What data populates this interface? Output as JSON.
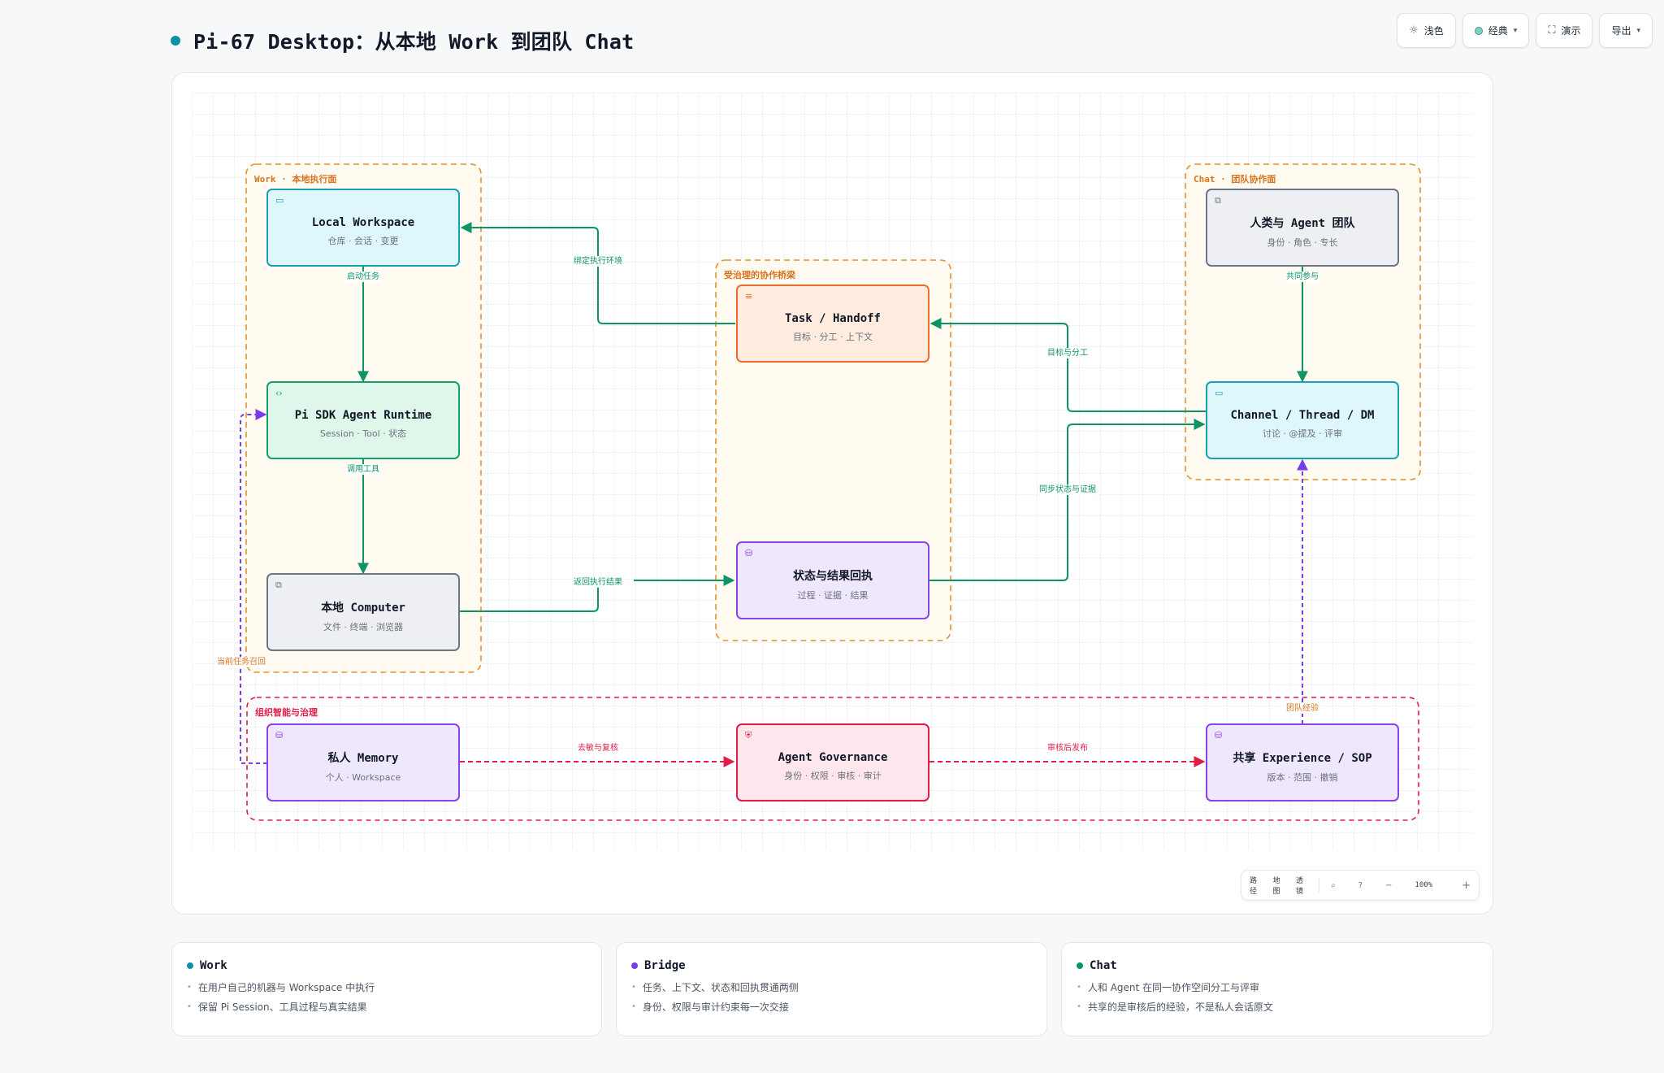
{
  "page": {
    "title": "Pi-67 Desktop：从本地 Work 到团队 Chat"
  },
  "toolbar": {
    "theme_label": "浅色",
    "style_label": "经典",
    "present_label": "演示",
    "export_label": "导出"
  },
  "groups": {
    "work": {
      "label": "Work · 本地执行面"
    },
    "bridge": {
      "label": "受治理的协作桥梁"
    },
    "chat": {
      "label": "Chat · 团队协作面"
    },
    "org": {
      "label": "组织智能与治理"
    }
  },
  "nodes": {
    "local_workspace": {
      "title": "Local Workspace",
      "sub": "仓库 · 会话 · 变更",
      "icon": "window-icon"
    },
    "agent_runtime": {
      "title": "Pi SDK Agent Runtime",
      "sub": "Session · Tool · 状态",
      "icon": "code-icon"
    },
    "local_computer": {
      "title": "本地 Computer",
      "sub": "文件 · 终端 · 浏览器",
      "icon": "external-link-icon"
    },
    "task_handoff": {
      "title": "Task / Handoff",
      "sub": "目标 · 分工 · 上下文",
      "icon": "list-icon"
    },
    "status_receipt": {
      "title": "状态与结果回执",
      "sub": "过程 · 证据 · 结果",
      "icon": "database-icon"
    },
    "team": {
      "title": "人类与 Agent 团队",
      "sub": "身份 · 角色 · 专长",
      "icon": "external-link-icon"
    },
    "channel": {
      "title": "Channel / Thread / DM",
      "sub": "讨论 · @提及 · 评审",
      "icon": "window-icon"
    },
    "memory": {
      "title": "私人 Memory",
      "sub": "个人 · Workspace",
      "icon": "database-icon"
    },
    "governance": {
      "title": "Agent Governance",
      "sub": "身份 · 权限 · 审核 · 审计",
      "icon": "shield-icon"
    },
    "experience": {
      "title": "共享 Experience / SOP",
      "sub": "版本 · 范围 · 撤销",
      "icon": "database-icon"
    }
  },
  "edges": {
    "start_task": "启动任务",
    "call_tool": "调用工具",
    "bind_env": "绑定执行环境",
    "return_result": "返回执行结果",
    "goal_split": "目标与分工",
    "sync_status": "同步状态与证据",
    "co_participate": "共同参与",
    "recall": "当前任务召回",
    "desensitize": "去敏与复核",
    "publish": "审核后发布",
    "team_exp": "团队经验"
  },
  "map_controls": {
    "path": "路径",
    "map": "地图",
    "lens": "透镜",
    "zoom": "100%",
    "minus": "−",
    "plus": "+"
  },
  "legend": [
    {
      "title": "Work",
      "color": "#0e8fa8",
      "lines": [
        "在用户自己的机器与 Workspace 中执行",
        "保留 Pi Session、工具过程与真实结果"
      ]
    },
    {
      "title": "Bridge",
      "color": "#7c3aed",
      "lines": [
        "任务、上下文、状态和回执贯通两侧",
        "身份、权限与审计约束每一次交接"
      ]
    },
    {
      "title": "Chat",
      "color": "#059669",
      "lines": [
        "人和 Agent 在同一协作空间分工与评审",
        "共享的是审核后的经验，不是私人会话原文"
      ]
    }
  ],
  "colors": {
    "green": "#0f9468",
    "purple": "#7c3aed",
    "red": "#e11d48",
    "orange": "#e0922f"
  }
}
